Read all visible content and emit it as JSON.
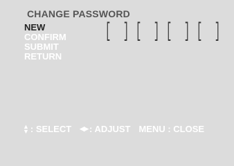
{
  "screen": {
    "title": "CHANGE PASSWORD"
  },
  "menu": {
    "items": [
      {
        "label": "NEW",
        "active": true
      },
      {
        "label": "CONFIRM",
        "active": false
      },
      {
        "label": "SUBMIT",
        "active": false
      },
      {
        "label": "RETURN",
        "active": false
      }
    ]
  },
  "code_field": {
    "slot_count": 4
  },
  "footer": {
    "select_label": ": SELECT",
    "adjust_label": ": ADJUST",
    "close_label": "MENU : CLOSE"
  },
  "colors": {
    "background": "#dcdcdc",
    "active_text": "#222222",
    "inactive_text": "#ffffff",
    "title_text": "#555555"
  },
  "icons": [
    "up-down-arrows-icon",
    "left-right-arrows-icon"
  ]
}
